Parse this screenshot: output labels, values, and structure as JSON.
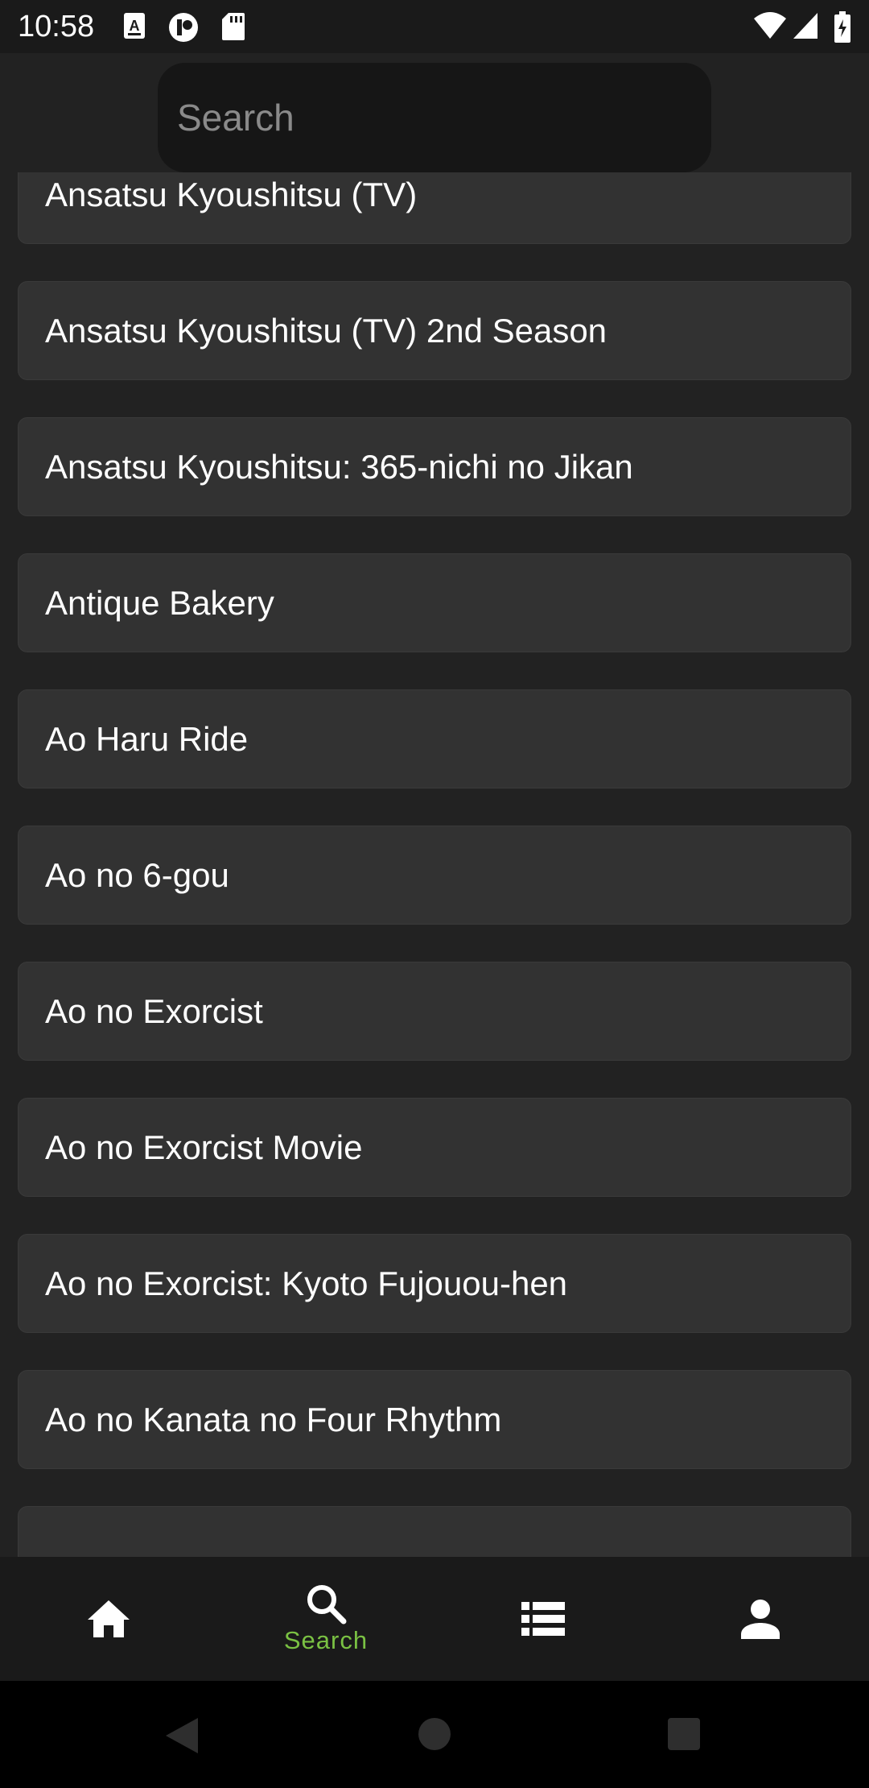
{
  "status_bar": {
    "time": "10:58",
    "left_icons": [
      "keyboard-a-icon",
      "app-icon",
      "sd-card-icon"
    ],
    "right_icons": [
      "wifi-icon",
      "signal-icon",
      "battery-icon"
    ]
  },
  "search": {
    "placeholder": "Search",
    "value": ""
  },
  "results": [
    "Ansatsu Kyoushitsu (TV)",
    "Ansatsu Kyoushitsu (TV) 2nd Season",
    "Ansatsu Kyoushitsu: 365-nichi no Jikan",
    "Antique Bakery",
    "Ao Haru Ride",
    "Ao no 6-gou",
    "Ao no Exorcist",
    "Ao no Exorcist Movie",
    "Ao no Exorcist: Kyoto Fujouou-hen",
    "Ao no Kanata no Four Rhythm"
  ],
  "bottom_nav": {
    "items": [
      {
        "icon": "home-icon",
        "label": ""
      },
      {
        "icon": "search-icon",
        "label": "Search",
        "active": true
      },
      {
        "icon": "list-icon",
        "label": ""
      },
      {
        "icon": "person-icon",
        "label": ""
      }
    ],
    "active_color": "#7ac143"
  },
  "colors": {
    "background": "#222222",
    "card": "#323232",
    "bar": "#1a1a1a",
    "accent": "#7ac143"
  }
}
